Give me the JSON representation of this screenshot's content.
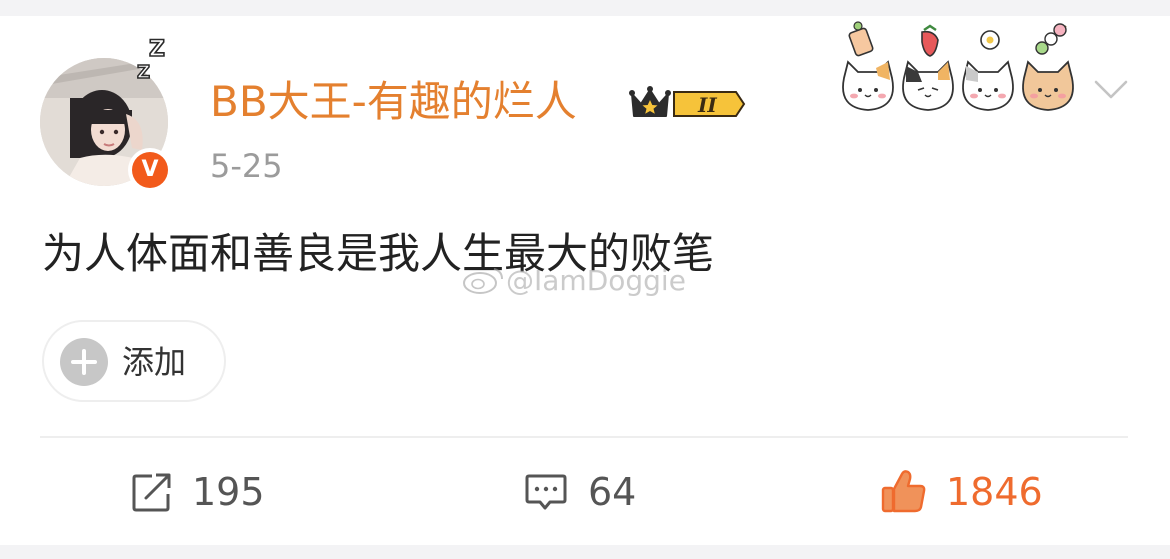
{
  "post": {
    "username": "BB大王-有趣的烂人",
    "date": "5-25",
    "text": "为人体面和善良是我人生最大的败笔",
    "watermark": "@IamDoggie",
    "verified_mark": "V",
    "member_level": "II"
  },
  "add_button": {
    "label": "添加"
  },
  "actions": {
    "repost_count": "195",
    "comment_count": "64",
    "like_count": "1846"
  },
  "colors": {
    "username": "#e4802f",
    "like": "#ef6b2e",
    "verified": "#f25a1b",
    "crown_gold": "#f2b31f"
  },
  "icons": {
    "repost": "share-out-icon",
    "comment": "comment-bubble-icon",
    "like": "thumbs-up-icon",
    "expand": "chevron-down-icon"
  }
}
